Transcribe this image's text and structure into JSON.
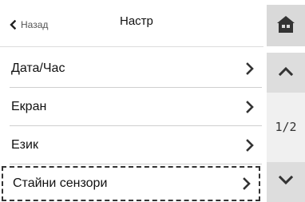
{
  "header": {
    "back_label": "Назад",
    "title": "Настр"
  },
  "menu": {
    "items": [
      {
        "label": "Дата/Час"
      },
      {
        "label": "Екран"
      },
      {
        "label": "Език"
      },
      {
        "label": "Стайни сензори"
      }
    ]
  },
  "pager": {
    "indicator": "1/2"
  },
  "icons": {
    "back": "chevron-left-icon",
    "home": "home-icon",
    "item_arrow": "chevron-right-icon",
    "page_up": "chevron-up-icon",
    "page_down": "chevron-down-icon"
  },
  "colors": {
    "button_gray": "#d9d9d9",
    "text": "#111111",
    "divider": "#cfcfcf"
  }
}
